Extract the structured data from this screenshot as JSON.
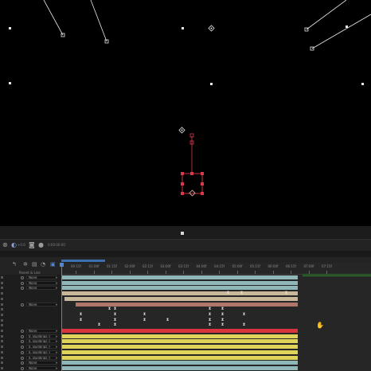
{
  "viewer": {
    "background": "#000000",
    "selection_color": "#d9394a"
  },
  "toolbar": {
    "zoom_value": "+0.0",
    "timecode": "0:00:00:00",
    "accent": "#8aa0d8"
  },
  "timeline": {
    "parent_link_header": "Parent & Link",
    "ruler_labels": [
      "00:15f",
      "01:00f",
      "01:15f",
      "02:00f",
      "02:15f",
      "03:00f",
      "03:15f",
      "04:00f",
      "04:15f",
      "05:00f",
      "05:15f",
      "06:00f",
      "06:15f",
      "07:00f",
      "07:15f"
    ],
    "playhead_color": "#4f86d8",
    "layers": [
      {
        "parent": "None",
        "track_color": "#8fb7b7"
      },
      {
        "parent": "None",
        "track_color": "#8fb7b7"
      },
      {
        "parent": "None",
        "track_color": "#8fb7b7"
      },
      {
        "parent": "",
        "track_color": "#c9b79a"
      },
      {
        "parent": "",
        "track_color": "#c9b79a"
      },
      {
        "parent": "None",
        "track_color": "#b0766a"
      },
      {
        "parent": "",
        "track_color": ""
      },
      {
        "parent": "",
        "track_color": ""
      },
      {
        "parent": "",
        "track_color": ""
      },
      {
        "parent": "",
        "track_color": ""
      },
      {
        "parent": "None",
        "track_color": "#d8353d"
      },
      {
        "parent": "6. Buildings_F",
        "track_color": "#e0d35a"
      },
      {
        "parent": "6. Buildings_F",
        "track_color": "#e0d35a"
      },
      {
        "parent": "6. Buildings_F",
        "track_color": "#e0d35a"
      },
      {
        "parent": "6. Buildings_F",
        "track_color": "#e0d35a"
      },
      {
        "parent": "6. Buildings_F",
        "track_color": "#e0d35a"
      },
      {
        "parent": "None",
        "track_color": "#8fb7b7"
      },
      {
        "parent": "None",
        "track_color": "#8fb7b7"
      }
    ]
  }
}
